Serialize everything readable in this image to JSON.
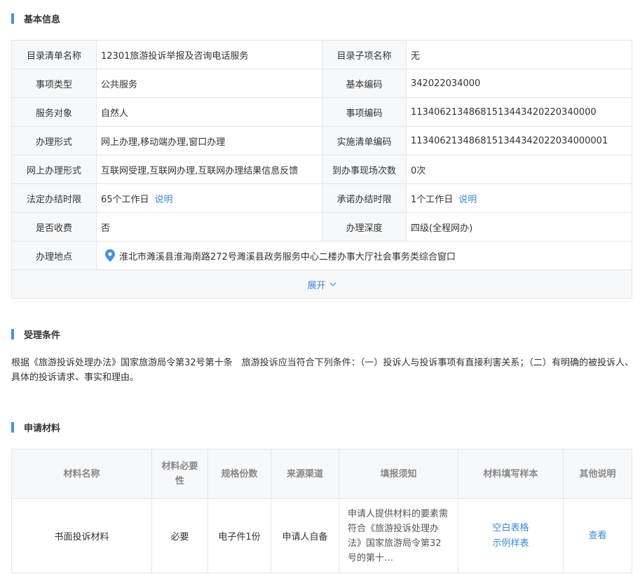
{
  "sections": {
    "basic_info": "基本信息",
    "conditions": "受理条件",
    "materials": "申请材料"
  },
  "info_rows": [
    {
      "l1": "目录清单名称",
      "v1": "12301旅游投诉举报及咨询电话服务",
      "l2": "目录子项名称",
      "v2": "无"
    },
    {
      "l1": "事项类型",
      "v1": "公共服务",
      "l2": "基本编码",
      "v2": "342022034000"
    },
    {
      "l1": "服务对象",
      "v1": "自然人",
      "l2": "事项编码",
      "v2": "11340621348681513443420220340000"
    },
    {
      "l1": "办理形式",
      "v1": "网上办理,移动端办理,窗口办理",
      "l2": "实施清单编码",
      "v2": "1134062134868151344342022034000001"
    },
    {
      "l1": "网上办理形式",
      "v1": "互联网受理,互联网办理,互联网办理结果信息反馈",
      "l2": "到办事现场次数",
      "v2": "0次"
    },
    {
      "l1": "法定办结时限",
      "v1": "65个工作日",
      "l2": "承诺办结时限",
      "v2": "1个工作日"
    },
    {
      "l1": "是否收费",
      "v1": "否",
      "l2": "办理深度",
      "v2": "四级(全程网办)"
    }
  ],
  "explain_link": "说明",
  "address": {
    "label": "办理地点",
    "value": "淮北市濉溪县淮海南路272号濉溪县政务服务中心二楼办事大厅社会事务类综合窗口"
  },
  "expand_label": "展开",
  "conditions_text": "根据《旅游投诉处理办法》国家旅游局令第32号第十条　旅游投诉应当符合下列条件：（一）投诉人与投诉事项有直接利害关系；（二）有明确的被投诉人、具体的投诉请求、事实和理由。",
  "materials": {
    "headers": [
      "材料名称",
      "材料必要性",
      "规格份数",
      "来源渠道",
      "填报须知",
      "材料填写样本",
      "其他说明"
    ],
    "rows": [
      {
        "name": "书面投诉材料",
        "required": "必要",
        "spec": "电子件1份",
        "source": "申请人自备",
        "notice": "申请人提供材料的要素需符合《旅游投诉处理办法》国家旅游局令第32号的第十…",
        "blank_form": "空白表格",
        "sample_form": "示例样表",
        "other": "查看"
      }
    ]
  },
  "colors": {
    "accent": "#4a90e2",
    "link": "#3c88d6",
    "label_bg": "#f7f8fa",
    "border": "#e6e6e6"
  },
  "icons": {
    "location": "map-pin-icon",
    "chevron": "chevron-down-icon"
  }
}
